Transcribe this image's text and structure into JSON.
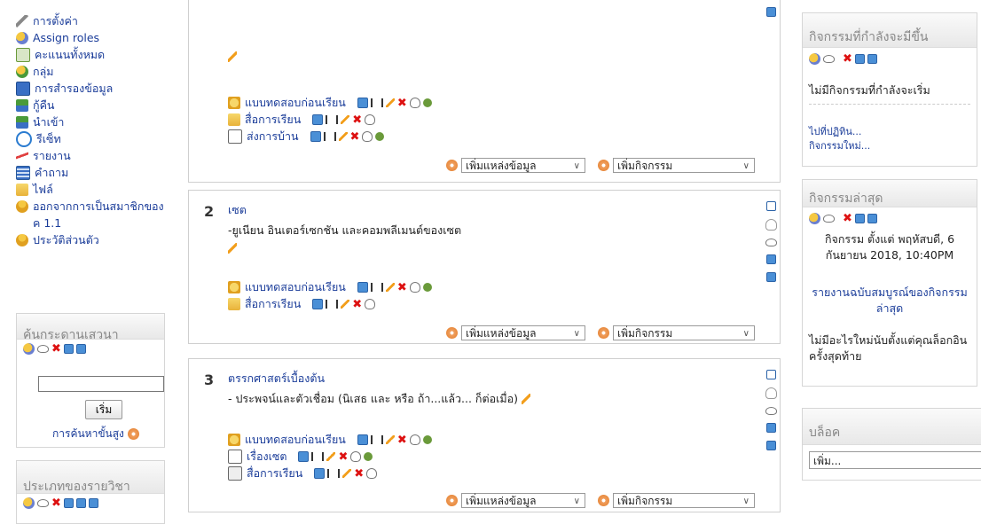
{
  "left_menu": {
    "items": [
      {
        "icon": "wrench-icon",
        "label": "การตั้งค่า"
      },
      {
        "icon": "assign-roles-icon",
        "label": "Assign roles"
      },
      {
        "icon": "grades-icon",
        "label": "คะแนนทั้งหมด"
      },
      {
        "icon": "groups-icon",
        "label": "กลุ่ม"
      },
      {
        "icon": "backup-icon",
        "label": "การสำรองข้อมูล"
      },
      {
        "icon": "restore-icon",
        "label": "กู้คืน"
      },
      {
        "icon": "import-icon",
        "label": "นำเข้า"
      },
      {
        "icon": "reset-icon",
        "label": "รีเซ็ท"
      },
      {
        "icon": "reports-icon",
        "label": "รายงาน"
      },
      {
        "icon": "questions-icon",
        "label": "คำถาม"
      },
      {
        "icon": "folder-icon",
        "label": "ไฟล์"
      },
      {
        "icon": "unenrol-icon",
        "label": "ออกจากการเป็นสมาชิกของ"
      },
      {
        "icon": "",
        "label": "ค 1.1"
      },
      {
        "icon": "profile-icon",
        "label": "ประวัติส่วนตัว"
      }
    ]
  },
  "search_block": {
    "title": "ค้นกระดานเสวนา",
    "input_value": "",
    "button_label": "เริ่ม",
    "advanced_label": "การค้นหาขั้นสูง"
  },
  "category_block": {
    "title": "ประเภทของรายวิชา"
  },
  "sections": {
    "s1": {
      "activities": [
        "แบบทดสอบก่อนเรียน",
        "สื่อการเรียน",
        "ส่งการบ้าน"
      ],
      "add_resource": "เพิ่มแหล่งข้อมูล",
      "add_activity": "เพิ่มกิจกรรม"
    },
    "s2": {
      "number": "2",
      "title": "เซต",
      "summary": "-ยูเนียน อินเตอร์เซกชัน และคอมพลีเมนต์ของเซต",
      "activities": [
        "แบบทดสอบก่อนเรียน",
        "สื่อการเรียน"
      ],
      "add_resource": "เพิ่มแหล่งข้อมูล",
      "add_activity": "เพิ่มกิจกรรม"
    },
    "s3": {
      "number": "3",
      "title": "ตรรกศาสตร์เบื้องต้น",
      "summary": "- ประพจน์และตัวเชื่อม (นิเสธ และ หรือ ถ้า...แล้ว... ก็ต่อเมื่อ)",
      "activities": [
        "แบบทดสอบก่อนเรียน",
        "เรื่องเซต",
        "สื่อการเรียน"
      ],
      "add_resource": "เพิ่มแหล่งข้อมูล",
      "add_activity": "เพิ่มกิจกรรม"
    }
  },
  "upcoming_block": {
    "title": "กิจกรรมที่กำลังจะมีขึ้น",
    "empty_text": "ไม่มีกิจกรรมที่กำลังจะเริ่ม",
    "link_calendar": "ไปที่ปฏิทิน...",
    "link_new_event": "กิจกรรมใหม่..."
  },
  "recent_block": {
    "title": "กิจกรรมล่าสุด",
    "since_text": "กิจกรรม ตั้งแต่ พฤหัสบดี, 6 กันยายน 2018, 10:40PM",
    "full_report_link": "รายงานฉบับสมบูรณ์ของกิจกรรมล่าสุด",
    "nothing_text": "ไม่มีอะไรใหม่นับตั้งแต่คุณล็อกอินครั้งสุดท้าย"
  },
  "blocks_block": {
    "title": "บล็อค",
    "select_value": "เพิ่ม..."
  }
}
